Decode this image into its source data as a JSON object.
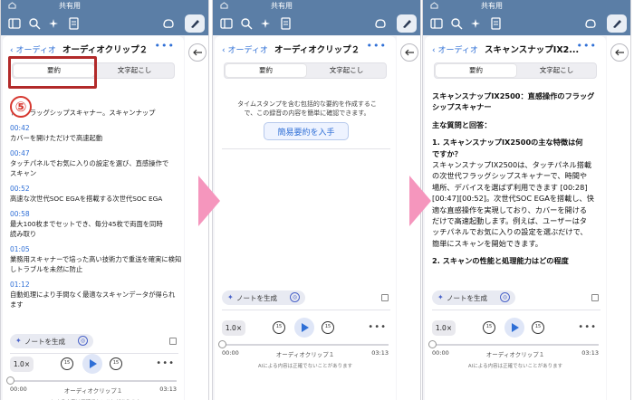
{
  "topbar": {
    "shared_label": "共有用"
  },
  "header": {
    "back_label": "オーディオ",
    "more_label": "•••"
  },
  "tabs": {
    "summary": "要約",
    "transcript": "文字起こし"
  },
  "step_badge": "⑤",
  "panel1": {
    "title": "オーディオクリップ２",
    "lines": [
      {
        "kind": "text",
        "text": "トラフラッグシップスキャナー。スキャンナップ"
      },
      {
        "kind": "ts",
        "text": "00:42"
      },
      {
        "kind": "text",
        "text": "カバーを開けただけで高速起動"
      },
      {
        "kind": "ts",
        "text": "00:47"
      },
      {
        "kind": "text",
        "text": "タッチパネルでお気に入りの設定を選び、直感操作で"
      },
      {
        "kind": "text",
        "text": "スキャン"
      },
      {
        "kind": "ts",
        "text": "00:52"
      },
      {
        "kind": "text",
        "text": "高速な次世代SOC EGAを搭載する次世代SOC EGA"
      },
      {
        "kind": "ts",
        "text": "00:58"
      },
      {
        "kind": "text",
        "text": "最大100枚までセットでき、毎分45枚で両面を同時"
      },
      {
        "kind": "text",
        "text": "読み取り"
      },
      {
        "kind": "ts",
        "text": "01:05"
      },
      {
        "kind": "text",
        "text": "業務用スキャナーで培った高い技術力で重送を確実に検知"
      },
      {
        "kind": "text",
        "text": "しトラブルを未然に防止"
      },
      {
        "kind": "ts",
        "text": "01:12"
      },
      {
        "kind": "text",
        "text": "自動処理により手間なく最適なスキャンデータが得られ"
      },
      {
        "kind": "text",
        "text": "ます"
      }
    ]
  },
  "panel2": {
    "title": "オーディオクリップ２",
    "hint_line1": "タイムスタンプを含む包括的な要約を作成するこ",
    "hint_line2": "で、この録音の内容を簡単に確認できます。",
    "summary_button": "簡易要約を入手"
  },
  "panel3": {
    "title": "スキャンスナップIX2...",
    "lines": [
      {
        "text": "スキャンスナップIX2500：直感操作のフラッグ",
        "style": "bold"
      },
      {
        "text": "シップスキャナー",
        "style": "bold"
      },
      {
        "text": "",
        "style": "plain"
      },
      {
        "text": "主な質問と回答：",
        "style": "bold"
      },
      {
        "text": "",
        "style": "plain"
      },
      {
        "text": "1. スキャンスナップIX2500の主な特徴は何",
        "style": "bold"
      },
      {
        "text": "ですか？",
        "style": "bold"
      },
      {
        "text": "スキャンスナップIX2500は、タッチパネル搭載",
        "style": "plain"
      },
      {
        "text": "の次世代フラッグシップスキャナーで、時間や",
        "style": "plain"
      },
      {
        "text": "場所、デバイスを選ばず利用できます [00:28]",
        "style": "plain"
      },
      {
        "text": "[00:47][00:52]。次世代SOC EGAを搭載し、快",
        "style": "plain"
      },
      {
        "text": "適な直感操作を実現しており、カバーを開ける",
        "style": "plain"
      },
      {
        "text": "だけで高速起動します。例えば、ユーザーはタ",
        "style": "plain"
      },
      {
        "text": "ッチパネルでお気に入りの設定を選ぶだけで、",
        "style": "plain"
      },
      {
        "text": "簡単にスキャンを開始できます。",
        "style": "plain"
      },
      {
        "text": "",
        "style": "plain"
      },
      {
        "text": "2. スキャンの性能と処理能力はどの程度",
        "style": "bold"
      }
    ]
  },
  "footer": {
    "generate_notes": "ノートを生成",
    "speed": "1.0×",
    "skip_back": "15",
    "skip_fwd": "15",
    "time_start": "00:00",
    "time_end": "03:13",
    "clip_name": "オーディオクリップ１",
    "clip_name3": "オーディオクリップ１",
    "notice": "AIによる内容は正確でないことがあります"
  }
}
